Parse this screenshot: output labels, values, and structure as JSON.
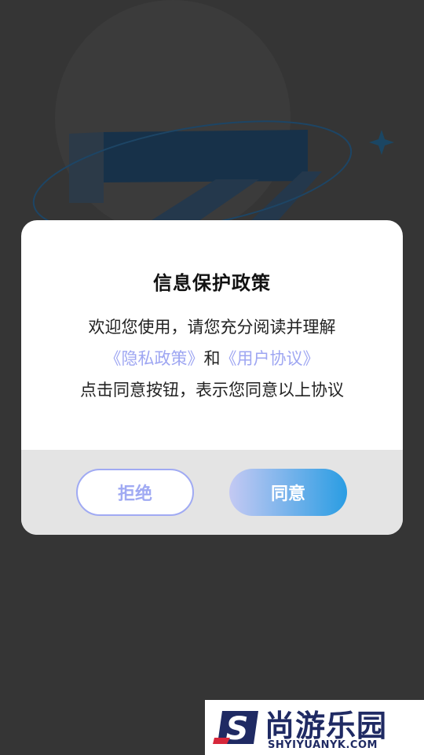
{
  "dialog": {
    "title": "信息保护政策",
    "line1": "欢迎您使用，请您充分阅读并理解",
    "privacy_link": "《隐私政策》",
    "connector": "和",
    "user_agreement_link": "《用户协议》",
    "line3": "点击同意按钮，表示您同意以上协议",
    "reject_label": "拒绝",
    "agree_label": "同意"
  },
  "watermark": {
    "logo_letter": "S",
    "title": "尚游乐园",
    "domain": "SHYIYUANYK.COM"
  },
  "colors": {
    "background": "#353535",
    "link": "#9ea6f2",
    "agree_gradient_start": "#c4c9f3",
    "agree_gradient_end": "#2a9de3"
  }
}
